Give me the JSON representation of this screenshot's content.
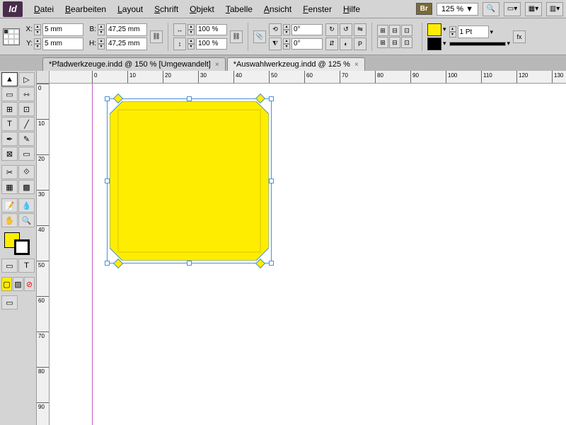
{
  "menu": {
    "items": [
      "Datei",
      "Bearbeiten",
      "Layout",
      "Schrift",
      "Objekt",
      "Tabelle",
      "Ansicht",
      "Fenster",
      "Hilfe"
    ],
    "bridge": "Br",
    "zoom": "125 %"
  },
  "control": {
    "x_label": "X:",
    "x_val": "5 mm",
    "y_label": "Y:",
    "y_val": "5 mm",
    "w_label": "B:",
    "w_val": "47,25 mm",
    "h_label": "H:",
    "h_val": "47,25 mm",
    "scale_x": "100 %",
    "scale_y": "100 %",
    "rotate": "0°",
    "shear": "0°",
    "stroke_weight": "1 Pt",
    "fill_color": "#ffed00",
    "stroke_color": "#000000"
  },
  "tabs": [
    {
      "label": "*Pfadwerkzeuge.indd @ 150 % [Umgewandelt]",
      "active": false
    },
    {
      "label": "*Auswahlwerkzeug.indd @ 125 %",
      "active": true
    }
  ],
  "ruler": {
    "h_ticks": [
      "0",
      "10",
      "20",
      "30",
      "40",
      "50",
      "60",
      "70",
      "80",
      "90",
      "100",
      "110",
      "120",
      "130"
    ],
    "v_ticks": [
      "0",
      "10",
      "20",
      "30",
      "40",
      "50",
      "60",
      "70",
      "80",
      "90"
    ]
  },
  "object": {
    "fill": "#ffed00",
    "stroke": "#4a90d9"
  }
}
